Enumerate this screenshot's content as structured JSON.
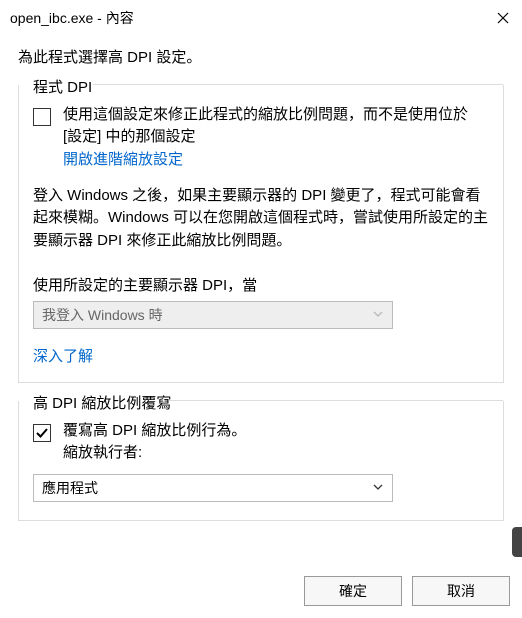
{
  "window": {
    "title": "open_ibc.exe - 內容"
  },
  "intro": "為此程式選擇高 DPI 設定。",
  "programDpi": {
    "groupLabel": "程式 DPI",
    "checkbox": {
      "checked": false,
      "text": "使用這個設定來修正此程式的縮放比例問題，而不是使用位於 [設定] 中的那個設定"
    },
    "advancedLink": "開啟進階縮放設定",
    "desc": "登入 Windows 之後，如果主要顯示器的 DPI 變更了，程式可能會看起來模糊。Windows 可以在您開啟這個程式時，嘗試使用所設定的主要顯示器 DPI 來修正此縮放比例問題。",
    "dpiLabel": "使用所設定的主要顯示器 DPI，當",
    "dpiDropdown": {
      "value": "我登入 Windows 時",
      "enabled": false
    },
    "learnMore": "深入了解"
  },
  "overrideDpi": {
    "groupLabel": "高 DPI 縮放比例覆寫",
    "checkbox": {
      "checked": true,
      "line1": "覆寫高 DPI 縮放比例行為。",
      "line2": "縮放執行者:"
    },
    "dropdown": {
      "value": "應用程式",
      "enabled": true
    }
  },
  "buttons": {
    "ok": "確定",
    "cancel": "取消"
  }
}
